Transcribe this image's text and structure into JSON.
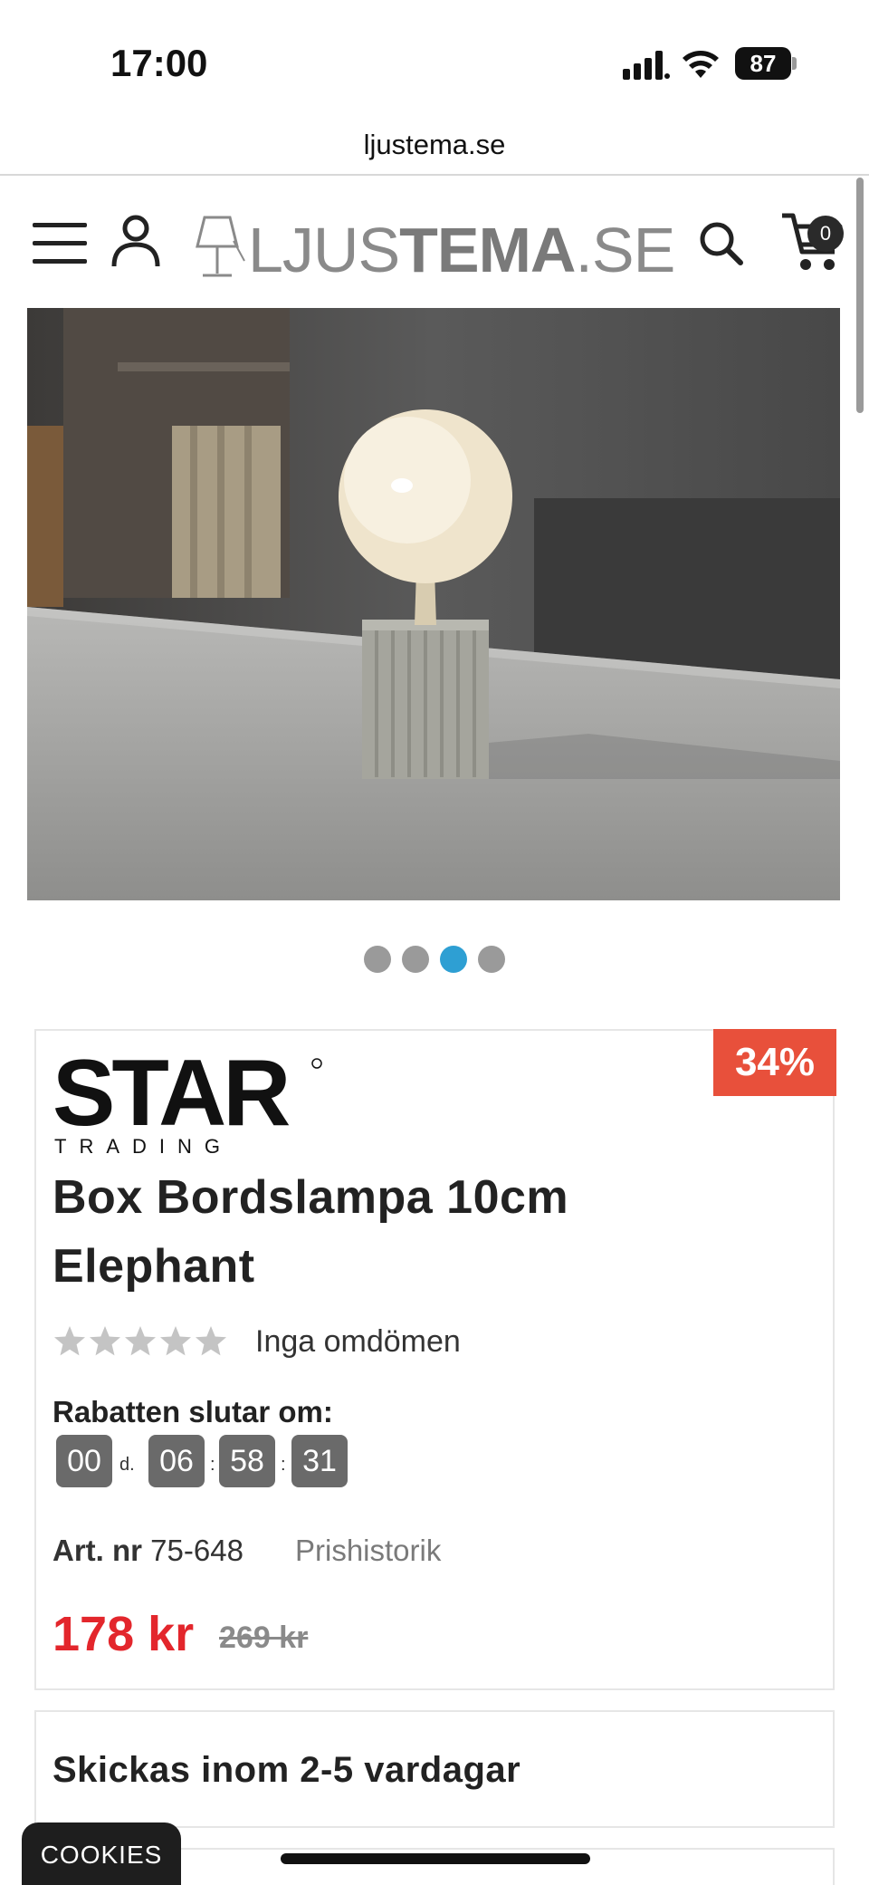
{
  "status_bar": {
    "time": "17:00",
    "battery": "87",
    "icons": [
      "signal-icon",
      "wifi-icon",
      "battery-icon"
    ]
  },
  "browser": {
    "url": "ljustema.se"
  },
  "header": {
    "logo_thin": "LJUS",
    "logo_bold": "TEMA",
    "logo_suffix": ".SE",
    "cart_count": "0",
    "icons": [
      "menu-icon",
      "user-icon",
      "search-icon",
      "cart-icon"
    ]
  },
  "gallery": {
    "dot_count": 4,
    "active_index": 2
  },
  "product": {
    "discount": "34%",
    "brand_name": "STAR",
    "brand_sub": "TRADING",
    "title": "Box Bordslampa 10cm Elephant",
    "rating_stars": 0,
    "rating_max": 5,
    "rating_text": "Inga omdömen",
    "countdown_label": "Rabatten slutar om:",
    "countdown": {
      "days": "00",
      "days_unit": "d.",
      "hours": "06",
      "minutes": "58",
      "seconds": "31"
    },
    "artnr_label": "Art. nr",
    "artnr_value": "75-648",
    "price_history_link": "Prishistorik",
    "price_current": "178 kr",
    "price_old": "269 kr"
  },
  "shipping": {
    "text": "Skickas inom 2-5 vardagar"
  },
  "cookies": {
    "label": "COOKIES"
  },
  "colors": {
    "discount_badge": "#e8503b",
    "price_current": "#e3262c",
    "dot_active": "#2e9fd3",
    "countdown_box": "#6a6a6a"
  }
}
